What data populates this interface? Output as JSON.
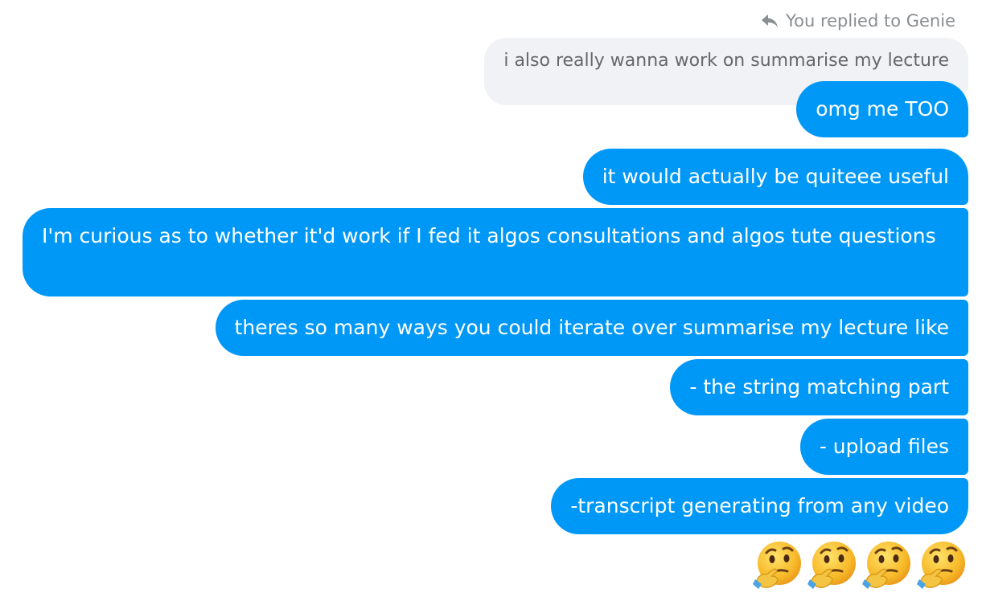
{
  "reply_header": {
    "text": "You replied to Genie"
  },
  "quoted_message": {
    "text": "i also really wanna work on summarise my lecture"
  },
  "messages": [
    "omg me TOO",
    "it would actually be quiteee useful",
    "I'm curious as to whether it'd work if I fed it algos consultations and algos tute questions",
    "theres so many ways you could iterate over summarise my lecture like",
    "- the string matching part",
    "- upload files",
    "-transcript generating from any video"
  ],
  "emoji_reactions": [
    "thinking-face",
    "thinking-face",
    "thinking-face",
    "thinking-face"
  ],
  "colors": {
    "sent_bubble": "#0098f7",
    "quoted_bubble": "#f0f2f5",
    "muted_text": "#8a8d91"
  }
}
